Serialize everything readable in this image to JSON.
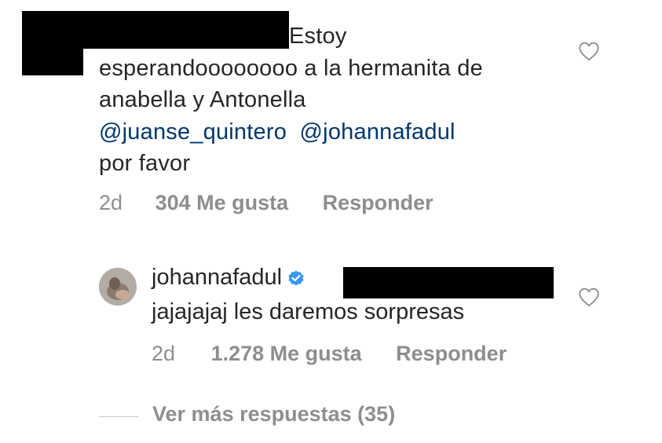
{
  "comment": {
    "lines": [
      "Estoy",
      "esperandoooooooo a la hermanita de",
      "anabella y Antonella"
    ],
    "mentions": [
      "@juanse_quintero",
      "@johannafadul"
    ],
    "last_line": "por favor",
    "time": "2d",
    "likes": "304 Me gusta",
    "reply_label": "Responder"
  },
  "reply": {
    "username": "johannafadul",
    "text": "jajajajaj les daremos sorpresas",
    "time": "2d",
    "likes": "1.278 Me gusta",
    "reply_label": "Responder"
  },
  "view_more": "Ver más respuestas (35)",
  "colors": {
    "mention": "#00376b",
    "meta": "#8e8e8e",
    "verified": "#3897f0"
  }
}
